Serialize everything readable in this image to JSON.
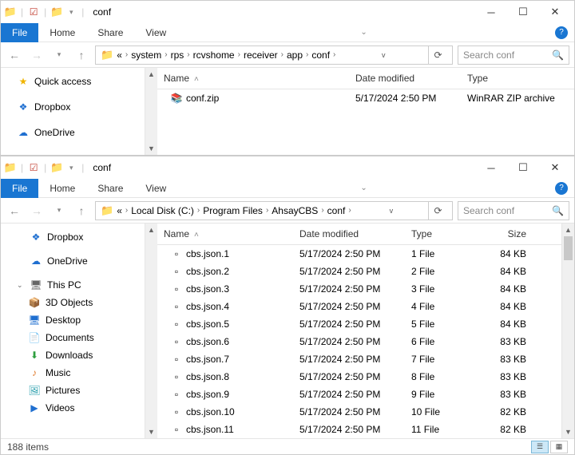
{
  "window1": {
    "title": "conf",
    "menu": {
      "file": "File",
      "home": "Home",
      "share": "Share",
      "view": "View"
    },
    "breadcrumb": [
      "system",
      "rps",
      "rcvshome",
      "receiver",
      "app",
      "conf"
    ],
    "search_placeholder": "Search conf",
    "sidebar": [
      {
        "icon": "star",
        "label": "Quick access"
      },
      {
        "icon": "dropbox",
        "label": "Dropbox"
      },
      {
        "icon": "onedrive",
        "label": "OneDrive"
      }
    ],
    "columns": {
      "name": "Name",
      "date": "Date modified",
      "type": "Type"
    },
    "files": [
      {
        "icon": "zip",
        "name": "conf.zip",
        "date": "5/17/2024 2:50 PM",
        "type": "WinRAR ZIP archive"
      }
    ]
  },
  "window2": {
    "title": "conf",
    "menu": {
      "file": "File",
      "home": "Home",
      "share": "Share",
      "view": "View"
    },
    "breadcrumb": [
      "Local Disk (C:)",
      "Program Files",
      "AhsayCBS",
      "conf"
    ],
    "search_placeholder": "Search conf",
    "sidebar": [
      {
        "icon": "dropbox",
        "label": "Dropbox"
      },
      {
        "icon": "onedrive",
        "label": "OneDrive"
      },
      {
        "icon": "pc",
        "label": "This PC",
        "expanded": true
      },
      {
        "icon": "3d",
        "label": "3D Objects",
        "sub": true
      },
      {
        "icon": "desktop",
        "label": "Desktop",
        "sub": true
      },
      {
        "icon": "docs",
        "label": "Documents",
        "sub": true
      },
      {
        "icon": "downloads",
        "label": "Downloads",
        "sub": true
      },
      {
        "icon": "music",
        "label": "Music",
        "sub": true
      },
      {
        "icon": "pictures",
        "label": "Pictures",
        "sub": true
      },
      {
        "icon": "videos",
        "label": "Videos",
        "sub": true
      }
    ],
    "columns": {
      "name": "Name",
      "date": "Date modified",
      "type": "Type",
      "size": "Size"
    },
    "files": [
      {
        "name": "cbs.json.1",
        "date": "5/17/2024 2:50 PM",
        "type": "1 File",
        "size": "84 KB"
      },
      {
        "name": "cbs.json.2",
        "date": "5/17/2024 2:50 PM",
        "type": "2 File",
        "size": "84 KB"
      },
      {
        "name": "cbs.json.3",
        "date": "5/17/2024 2:50 PM",
        "type": "3 File",
        "size": "84 KB"
      },
      {
        "name": "cbs.json.4",
        "date": "5/17/2024 2:50 PM",
        "type": "4 File",
        "size": "84 KB"
      },
      {
        "name": "cbs.json.5",
        "date": "5/17/2024 2:50 PM",
        "type": "5 File",
        "size": "84 KB"
      },
      {
        "name": "cbs.json.6",
        "date": "5/17/2024 2:50 PM",
        "type": "6 File",
        "size": "83 KB"
      },
      {
        "name": "cbs.json.7",
        "date": "5/17/2024 2:50 PM",
        "type": "7 File",
        "size": "83 KB"
      },
      {
        "name": "cbs.json.8",
        "date": "5/17/2024 2:50 PM",
        "type": "8 File",
        "size": "83 KB"
      },
      {
        "name": "cbs.json.9",
        "date": "5/17/2024 2:50 PM",
        "type": "9 File",
        "size": "83 KB"
      },
      {
        "name": "cbs.json.10",
        "date": "5/17/2024 2:50 PM",
        "type": "10 File",
        "size": "82 KB"
      },
      {
        "name": "cbs.json.11",
        "date": "5/17/2024 2:50 PM",
        "type": "11 File",
        "size": "82 KB"
      }
    ],
    "status": "188 items"
  }
}
